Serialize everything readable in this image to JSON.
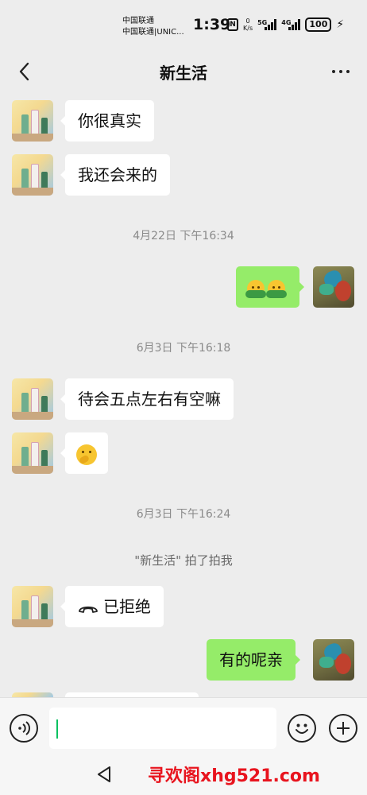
{
  "status_bar": {
    "carrier_1": "中国联通",
    "carrier_2": "中国联通|UNIC...",
    "time": "1:39",
    "nfc": "N",
    "speed_value": "0",
    "speed_unit": "K/s",
    "net_1": "5G",
    "net_2": "4G",
    "battery": "100"
  },
  "header": {
    "title": "新生活"
  },
  "messages": [
    {
      "side": "left",
      "text": "你很真实"
    },
    {
      "side": "left",
      "text": "我还会来的"
    },
    {
      "type": "time",
      "text": "4月22日 下午16:34"
    },
    {
      "side": "right",
      "type": "emoji"
    },
    {
      "type": "time",
      "text": "6月3日 下午16:18"
    },
    {
      "side": "left",
      "text": "待会五点左右有空嘛"
    },
    {
      "side": "left",
      "type": "emoji"
    },
    {
      "type": "time",
      "text": "6月3日 下午16:24"
    },
    {
      "type": "system",
      "text": "\"新生活\" 拍了拍我"
    },
    {
      "side": "left",
      "type": "call",
      "text": "已拒绝"
    },
    {
      "side": "right",
      "text": "有的呢亲"
    }
  ],
  "input": {
    "value": ""
  },
  "watermark": "寻欢阁xhg521.com"
}
